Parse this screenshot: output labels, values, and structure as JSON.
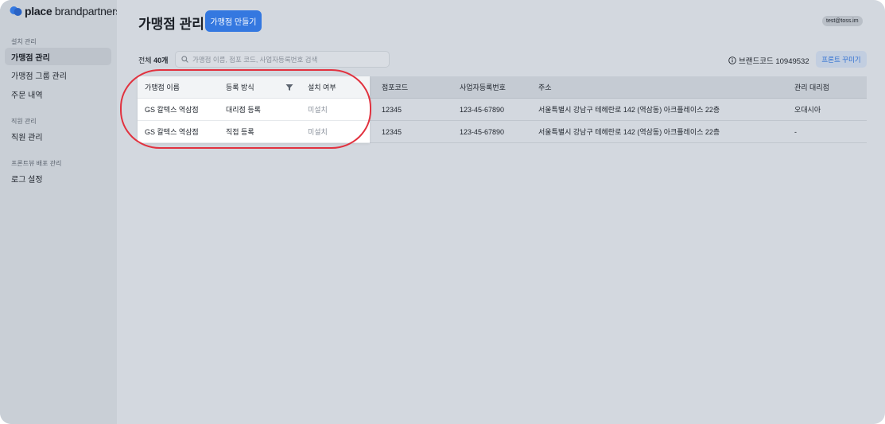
{
  "app": {
    "logo_bold": "place",
    "logo_rest": " brandpartners",
    "brand_color": "#3478e0",
    "highlight_color": "#e1323f"
  },
  "sidebar": {
    "sections": [
      {
        "title": "설치 관리",
        "items": [
          {
            "label": "가맹점 관리",
            "active": true
          },
          {
            "label": "가맹점 그룹 관리",
            "active": false
          },
          {
            "label": "주문 내역",
            "active": false
          }
        ]
      },
      {
        "title": "직원 관리",
        "items": [
          {
            "label": "직원 관리",
            "active": false
          }
        ]
      },
      {
        "title": "프론트뷰 배포 관리",
        "items": [
          {
            "label": "로그 설정",
            "active": false
          }
        ]
      }
    ]
  },
  "header": {
    "title": "가맹점 관리",
    "create_label": "가맹점 만들기",
    "user_email": "test@toss.im"
  },
  "toolbar": {
    "total_prefix": "전체 ",
    "total_count": "40개",
    "search_placeholder": "가맹점 이름, 점포 코드, 사업자등록번호 검색",
    "search_value": "",
    "brand_code_label": "브랜드코드 10949532",
    "front_btn_label": "프론트 꾸미기"
  },
  "table": {
    "columns": [
      "가맹점 이름",
      "등록 방식",
      "설치 여부",
      "점포코드",
      "사업자등록번호",
      "주소",
      "관리 대리점"
    ],
    "rows": [
      [
        "GS 칼텍스 역삼점",
        "대리점 등록",
        "미설치",
        "12345",
        "123-45-67890",
        "서울특별시 강남구 테헤란로 142 (역삼동) 아크플레이스 22층",
        "오대시아"
      ],
      [
        "GS 칼텍스 역삼점",
        "직접 등록",
        "미설치",
        "12345",
        "123-45-67890",
        "서울특별시 강남구 테헤란로 142 (역삼동) 아크플레이스 22층",
        "-"
      ]
    ]
  }
}
